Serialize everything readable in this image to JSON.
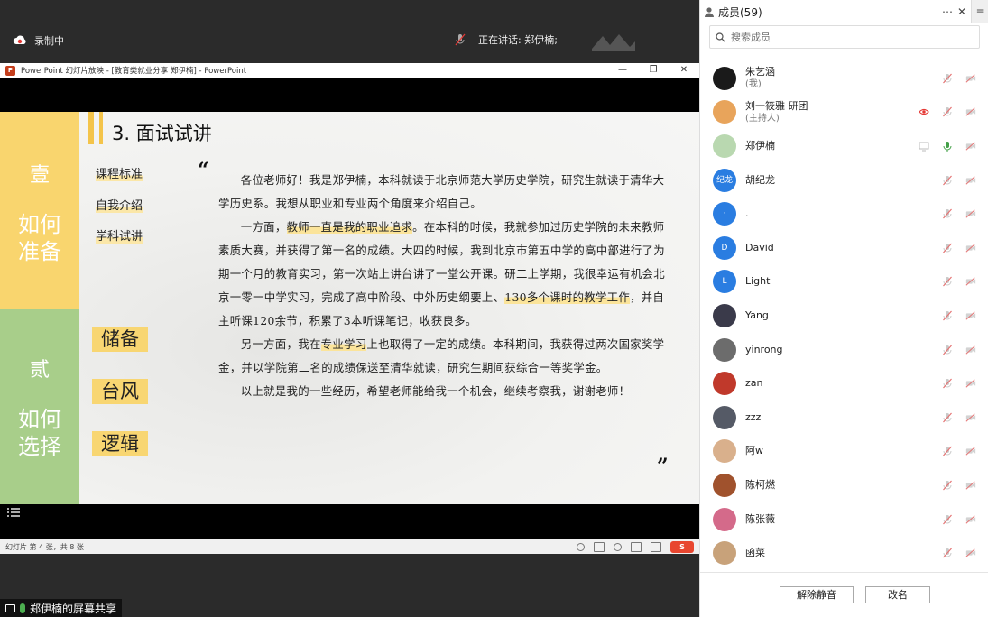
{
  "meeting": {
    "recording_label": "录制中",
    "speaking_label": "正在讲话: 郑伊楠;",
    "share_label": "郑伊楠的屏幕共享"
  },
  "ppt": {
    "window_title": "PowerPoint 幻灯片放映 - [教育类就业分享 郑伊楠] - PowerPoint",
    "controls": [
      "—",
      "❐",
      "✕"
    ],
    "status_text": "幻灯片 第 4 张，共 8 张"
  },
  "slide": {
    "band_top_num": "壹",
    "band_top_text": "如何准备",
    "band_bottom_num": "贰",
    "band_bottom_text": "如何选择",
    "title": "3. 面试试讲",
    "menu": [
      "课程标准",
      "自我介绍",
      "学科试讲"
    ],
    "tags": [
      "储备",
      "台风",
      "逻辑"
    ],
    "quote_open": "“",
    "quote_close": "”",
    "paragraphs": [
      {
        "pre": "各位老师好！我是郑伊楠，本科就读于北京师范大学历史学院，研究生就读于清华大学历史系。我想从职业和专业两个角度来介绍自己。",
        "hl": "",
        "post": ""
      },
      {
        "pre": "一方面，",
        "hl": "教师一直是我的职业追求",
        "post": "。在本科的时候，我就参加过历史学院的未来教师素质大赛，并获得了第一名的成绩。大四的时候，我到北京市第五中学的高中部进行了为期一个月的教育实习，第一次站上讲台讲了一堂公开课。研二上学期，我很幸运有机会北京一零一中学实习，完成了高中阶段、中外历史纲要上、"
      },
      {
        "pre": "",
        "hl": "130多个课时的教学工作",
        "post": "，并自主听课120余节，积累了3本听课笔记，收获良多。"
      },
      {
        "pre": "另一方面，我在",
        "hl": "专业学习",
        "post": "上也取得了一定的成绩。本科期间，我获得过两次国家奖学金，并以学院第二名的成绩保送至清华就读，研究生期间获综合一等奖学金。"
      },
      {
        "pre": "以上就是我的一些经历，希望老师能给我一个机会，继续考察我，谢谢老师！",
        "hl": "",
        "post": ""
      }
    ]
  },
  "panel": {
    "title": "成员(59)",
    "search_placeholder": "搜索成员",
    "buttons": {
      "unmute_all": "解除静音",
      "rename": "改名"
    },
    "members": [
      {
        "name": "朱艺涵",
        "role": "(我)",
        "avatar_color": "#1a1a1a",
        "avatar_text": "",
        "mic": "muted",
        "screen": false,
        "eye": false
      },
      {
        "name": "刘一筱雅 研团",
        "role": "(主持人)",
        "avatar_color": "#e8a45b",
        "avatar_text": "",
        "mic": "muted",
        "screen": false,
        "eye": true
      },
      {
        "name": "郑伊楠",
        "role": "",
        "avatar_color": "#b9d8b0",
        "avatar_text": "",
        "mic": "active",
        "screen": true,
        "eye": false
      },
      {
        "name": "胡纪龙",
        "role": "",
        "avatar_color": "#2a7de1",
        "avatar_text": "纪龙",
        "mic": "muted",
        "screen": false,
        "eye": false
      },
      {
        "name": ".",
        "role": "",
        "avatar_color": "#2a7de1",
        "avatar_text": "·",
        "mic": "muted",
        "screen": false,
        "eye": false
      },
      {
        "name": "David",
        "role": "",
        "avatar_color": "#2a7de1",
        "avatar_text": "D",
        "mic": "muted",
        "screen": false,
        "eye": false
      },
      {
        "name": "Light",
        "role": "",
        "avatar_color": "#2a7de1",
        "avatar_text": "L",
        "mic": "muted",
        "screen": false,
        "eye": false
      },
      {
        "name": "Yang",
        "role": "",
        "avatar_color": "#3a3a4a",
        "avatar_text": "",
        "mic": "muted",
        "screen": false,
        "eye": false
      },
      {
        "name": "yinrong",
        "role": "",
        "avatar_color": "#6c6c6c",
        "avatar_text": "",
        "mic": "muted",
        "screen": false,
        "eye": false
      },
      {
        "name": "zan",
        "role": "",
        "avatar_color": "#c0392b",
        "avatar_text": "",
        "mic": "muted",
        "screen": false,
        "eye": false
      },
      {
        "name": "zzz",
        "role": "",
        "avatar_color": "#555a66",
        "avatar_text": "",
        "mic": "muted",
        "screen": false,
        "eye": false
      },
      {
        "name": "阿w",
        "role": "",
        "avatar_color": "#d9b08c",
        "avatar_text": "",
        "mic": "muted",
        "screen": false,
        "eye": false
      },
      {
        "name": "陈柯燃",
        "role": "",
        "avatar_color": "#a0522d",
        "avatar_text": "",
        "mic": "muted",
        "screen": false,
        "eye": false
      },
      {
        "name": "陈张薇",
        "role": "",
        "avatar_color": "#d46a8a",
        "avatar_text": "",
        "mic": "muted",
        "screen": false,
        "eye": false
      },
      {
        "name": "函菜",
        "role": "",
        "avatar_color": "#c8a27a",
        "avatar_text": "",
        "mic": "muted",
        "screen": false,
        "eye": false
      }
    ]
  }
}
